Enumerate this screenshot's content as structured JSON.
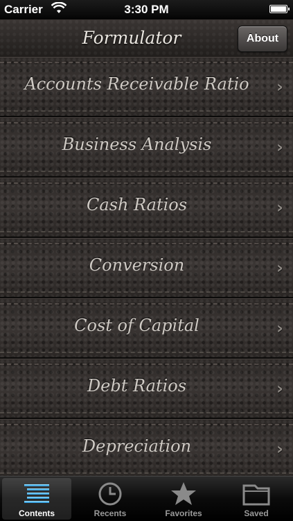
{
  "status_bar": {
    "carrier": "Carrier",
    "time": "3:30 PM"
  },
  "nav": {
    "title": "Formulator",
    "about_label": "About"
  },
  "list": {
    "items": [
      {
        "label": "Accounts Receivable Ratio"
      },
      {
        "label": "Business Analysis"
      },
      {
        "label": "Cash Ratios"
      },
      {
        "label": "Conversion"
      },
      {
        "label": "Cost of Capital"
      },
      {
        "label": "Debt Ratios"
      },
      {
        "label": "Depreciation"
      }
    ]
  },
  "tabs": [
    {
      "label": "Contents",
      "icon": "list-icon",
      "selected": true
    },
    {
      "label": "Recents",
      "icon": "clock-icon",
      "selected": false
    },
    {
      "label": "Favorites",
      "icon": "star-icon",
      "selected": false
    },
    {
      "label": "Saved",
      "icon": "folder-icon",
      "selected": false
    }
  ]
}
